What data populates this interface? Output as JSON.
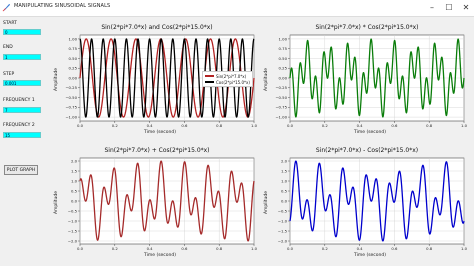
{
  "window": {
    "title": "MANIPULATING SINUSOIDAL SIGNALS",
    "minimize_glyph": "–",
    "maximize_glyph": "☐",
    "close_glyph": "✕"
  },
  "sidebar": {
    "start_label": "START",
    "start_value": "0",
    "end_label": "END",
    "end_value": "1",
    "step_label": "STEP",
    "step_value": "0.001",
    "freq1_label": "FREQUENCY 1",
    "freq1_value": "7",
    "freq2_label": "FREQUENCY 2",
    "freq2_value": "15",
    "plot_button": "PLOT GRAPH",
    "field_color": "#00ffff"
  },
  "plots": {
    "p1": {
      "title": "Sin(2*pi*7.0*x) and Cos(2*pi*15.0*x)",
      "xlabel": "Time (second)",
      "ylabel": "Amplitude",
      "legend": [
        "Sin(2*pi*7.0*x)",
        "Cos(2*pi*15.0*x)"
      ]
    },
    "p2": {
      "title": "Sin(2*pi*7.0*x) * Cos(2*pi*15.0*x)",
      "xlabel": "Time (second)",
      "ylabel": "Amplitude"
    },
    "p3": {
      "title": "Sin(2*pi*7.0*x) + Cos(2*pi*15.0*x)",
      "xlabel": "Time (second)",
      "ylabel": "Amplitude"
    },
    "p4": {
      "title": "Sin(2*pi*7.0*x) - Cos(2*pi*15.0*x)",
      "xlabel": "Time (second)",
      "ylabel": "Amplitude"
    }
  },
  "chart_data": [
    {
      "type": "line",
      "title": "Sin(2*pi*7.0*x) and Cos(2*pi*15.0*x)",
      "xlabel": "Time (second)",
      "ylabel": "Amplitude",
      "xlim": [
        0,
        1
      ],
      "ylim": [
        -1.1,
        1.1
      ],
      "xticks": [
        "0.0",
        "0.2",
        "0.4",
        "0.6",
        "0.8",
        "1.0"
      ],
      "yticks": [
        "−1.00",
        "−0.75",
        "−0.50",
        "−0.25",
        "0.00",
        "0.25",
        "0.50",
        "0.75",
        "1.00"
      ],
      "grid": true,
      "legend_position": "right",
      "series": [
        {
          "name": "Sin(2*pi*7.0*x)",
          "freq": 7,
          "fn": "sin",
          "color": "#b22222"
        },
        {
          "name": "Cos(2*pi*15.0*x)",
          "freq": 15,
          "fn": "cos",
          "color": "#000000"
        }
      ]
    },
    {
      "type": "line",
      "title": "Sin(2*pi*7.0*x) * Cos(2*pi*15.0*x)",
      "xlabel": "Time (second)",
      "ylabel": "Amplitude",
      "xlim": [
        0,
        1
      ],
      "ylim": [
        -1.1,
        1.1
      ],
      "xticks": [
        "0.0",
        "0.2",
        "0.4",
        "0.6",
        "0.8",
        "1.0"
      ],
      "yticks": [
        "−1.00",
        "−0.75",
        "−0.50",
        "−0.25",
        "0.00",
        "0.25",
        "0.50",
        "0.75",
        "1.00"
      ],
      "grid": true,
      "series": [
        {
          "op": "product",
          "f1": 7,
          "f2": 15,
          "color": "#0a7d0a"
        }
      ]
    },
    {
      "type": "line",
      "title": "Sin(2*pi*7.0*x) + Cos(2*pi*15.0*x)",
      "xlabel": "Time (second)",
      "ylabel": "Amplitude",
      "xlim": [
        0,
        1
      ],
      "ylim": [
        -2.15,
        2.15
      ],
      "xticks": [
        "0.0",
        "0.2",
        "0.4",
        "0.6",
        "0.8",
        "1.0"
      ],
      "yticks": [
        "−2.0",
        "−1.5",
        "−1.0",
        "−0.5",
        "0.0",
        "0.5",
        "1.0",
        "1.5",
        "2.0"
      ],
      "grid": true,
      "series": [
        {
          "op": "sum",
          "f1": 7,
          "f2": 15,
          "color": "#a52a2a"
        }
      ]
    },
    {
      "type": "line",
      "title": "Sin(2*pi*7.0*x) - Cos(2*pi*15.0*x)",
      "xlabel": "Time (second)",
      "ylabel": "Amplitude",
      "xlim": [
        0,
        1
      ],
      "ylim": [
        -2.15,
        2.15
      ],
      "xticks": [
        "0.0",
        "0.2",
        "0.4",
        "0.6",
        "0.8",
        "1.0"
      ],
      "yticks": [
        "−2.0",
        "−1.5",
        "−1.0",
        "−0.5",
        "0.0",
        "0.5",
        "1.0",
        "1.5",
        "2.0"
      ],
      "grid": true,
      "series": [
        {
          "op": "diff",
          "f1": 7,
          "f2": 15,
          "color": "#0000cd"
        }
      ]
    }
  ]
}
